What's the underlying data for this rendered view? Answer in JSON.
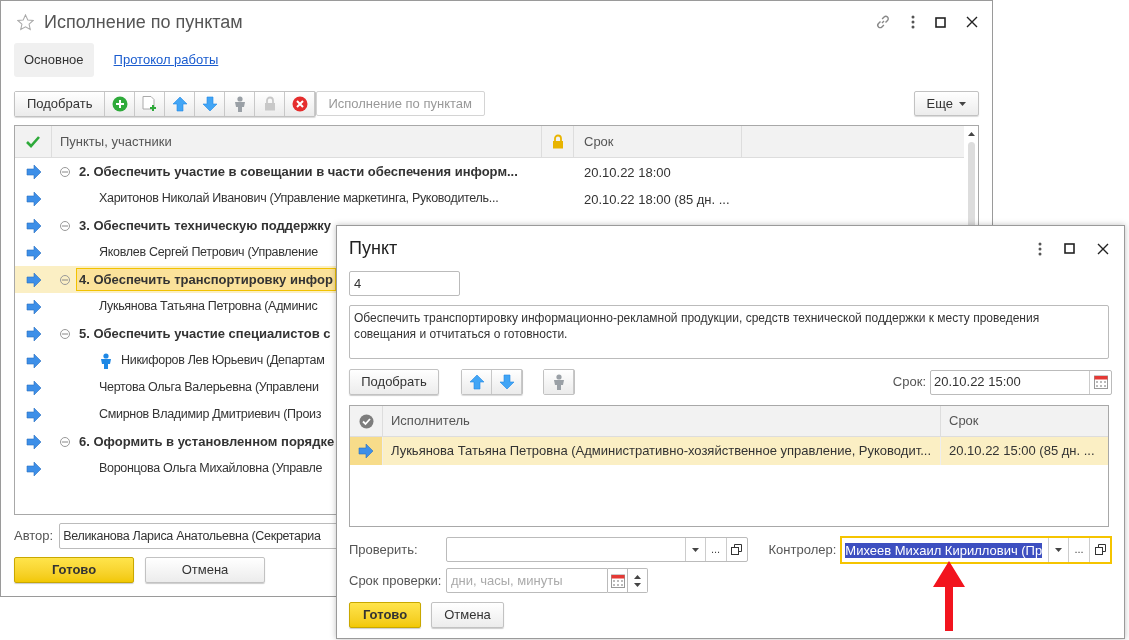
{
  "main_window": {
    "title": "Исполнение по пунктам",
    "tabs": [
      {
        "label": "Основное",
        "selected": true
      },
      {
        "label": "Протокол работы",
        "selected": false
      }
    ],
    "toolbar": {
      "pick_button": "Подобрать",
      "search_placeholder": "Исполнение по пунктам",
      "more_button": "Еще"
    },
    "table": {
      "columns": [
        "Пункты, участники",
        "Срок"
      ],
      "rows": [
        {
          "text": "2. Обеспечить участие в совещании в части обеспечения информ...",
          "date": "20.10.22 18:00",
          "expanded": true,
          "selected": false,
          "children": [
            {
              "text": "Харитонов Николай Иванович (Управление маркетинга, Руководитель...",
              "date": "20.10.22 18:00 (85 дн. ...",
              "kind": "plain",
              "selected": false
            }
          ]
        },
        {
          "text": "3. Обеспечить техническую поддержку",
          "expanded": true,
          "selected": false,
          "children": [
            {
              "text": "Яковлев Сергей Петрович (Управление",
              "kind": "plain",
              "selected": false
            }
          ]
        },
        {
          "text": "4. Обеспечить транспортировку инфор",
          "expanded": true,
          "selected": true,
          "children": [
            {
              "text": "Лукьянова Татьяна Петровна (Админис",
              "kind": "plain",
              "selected": false
            }
          ]
        },
        {
          "text": "5. Обеспечить участие специалистов с",
          "expanded": true,
          "selected": false,
          "children": [
            {
              "text": "Никифоров Лев Юрьевич (Департам",
              "kind": "responsible",
              "selected": false
            },
            {
              "text": "Чертова Ольга Валерьевна (Управлени",
              "kind": "plain",
              "selected": false
            },
            {
              "text": "Смирнов Владимир Дмитриевич (Произ",
              "kind": "plain",
              "selected": false
            }
          ]
        },
        {
          "text": "6. Оформить в установленном порядке",
          "expanded": true,
          "selected": false,
          "children": [
            {
              "text": "Воронцова Ольга Михайловна (Управле",
              "kind": "plain",
              "selected": false
            }
          ]
        }
      ]
    },
    "author_label": "Автор:",
    "author_value": "Великанова Лариса Анатольевна (Секретариа",
    "ok_button": "Готово",
    "cancel_button": "Отмена"
  },
  "dialog": {
    "title": "Пункт",
    "number": "4",
    "description": "Обеспечить транспортировку информационно-рекламной продукции, средств технической поддержки к месту проведения совещания и отчитаться о готовности.",
    "pick_button": "Подобрать",
    "due_label": "Срок:",
    "due_value": "20.10.22 15:00",
    "table": {
      "columns": [
        "Исполнитель",
        "Срок"
      ],
      "rows": [
        {
          "executor": "Лукьянова Татьяна Петровна (Административно-хозяйственное управление, Руководит...",
          "date": "20.10.22 15:00 (85 дн. ...",
          "selected": true
        }
      ]
    },
    "check_label": "Проверить:",
    "ellipsis": "...",
    "controller_label": "Контролер:",
    "controller_value": "Михеев Михаил Кириллович (Пр",
    "check_term_label": "Срок проверки:",
    "check_term_placeholder": "дни, часы, минуты",
    "ok_button": "Готово",
    "cancel_button": "Отмена"
  }
}
